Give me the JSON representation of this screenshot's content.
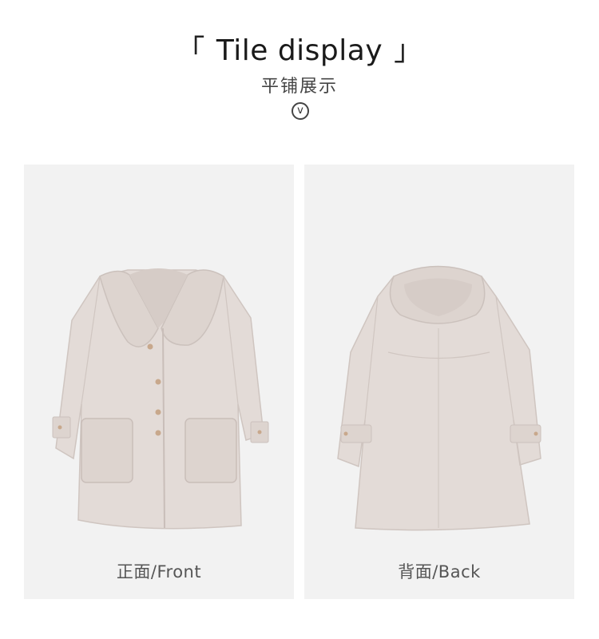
{
  "header": {
    "bracket_open": "「",
    "title": "Tile display",
    "bracket_close": "」",
    "subtitle": "平铺展示",
    "down_glyph": "v"
  },
  "panels": [
    {
      "caption": "正面/Front",
      "view": "front"
    },
    {
      "caption": "背面/Back",
      "view": "back"
    }
  ],
  "colors": {
    "panel_bg": "#f2f2f2",
    "coat": "#e3dbd7",
    "coat_shadow": "#d3c9c4",
    "button": "#c8a88c"
  }
}
